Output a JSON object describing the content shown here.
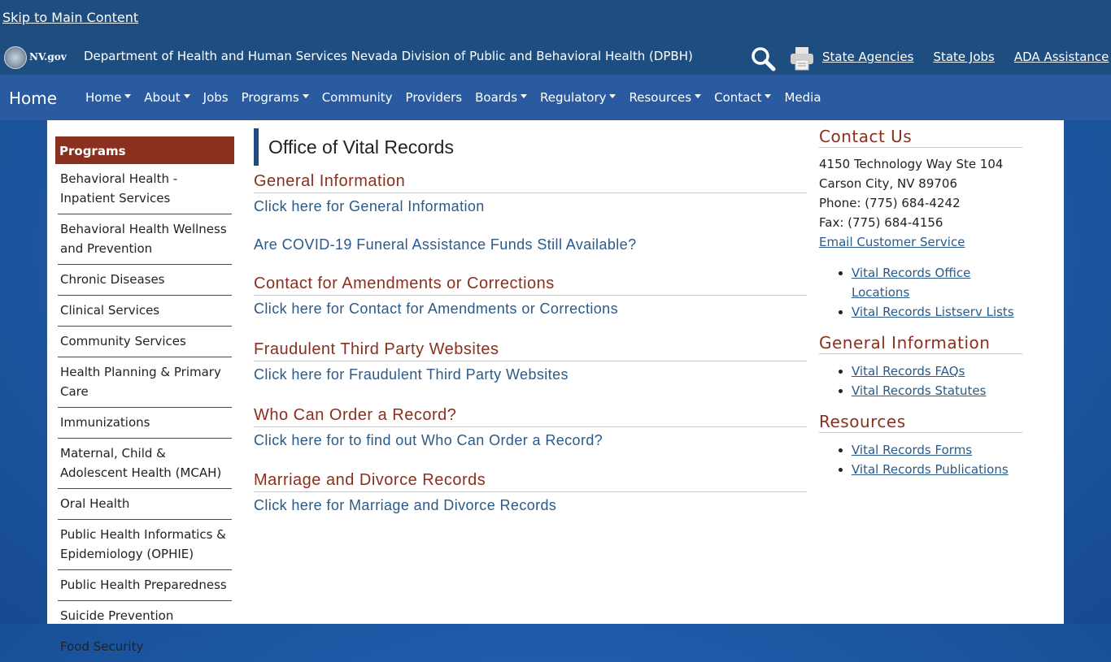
{
  "skip_link": "Skip to Main Content",
  "header": {
    "logo_text": "NV.gov",
    "agency_title": "Department of Health and Human Services Nevada Division of Public and Behavioral Health (DPBH)",
    "links": [
      "State Agencies",
      "State Jobs",
      "ADA Assistance"
    ]
  },
  "nav": {
    "brand": "Home",
    "items": [
      {
        "label": "Home",
        "dropdown": true
      },
      {
        "label": "About",
        "dropdown": true
      },
      {
        "label": "Jobs",
        "dropdown": false
      },
      {
        "label": "Programs",
        "dropdown": true
      },
      {
        "label": "Community",
        "dropdown": false
      },
      {
        "label": "Providers",
        "dropdown": false
      },
      {
        "label": "Boards",
        "dropdown": true
      },
      {
        "label": "Regulatory",
        "dropdown": true
      },
      {
        "label": "Resources",
        "dropdown": true
      },
      {
        "label": "Contact",
        "dropdown": true
      },
      {
        "label": "Media",
        "dropdown": false
      }
    ]
  },
  "sidebar": {
    "heading": "Programs",
    "items": [
      "Behavioral Health - Inpatient Services",
      "Behavioral Health Wellness and Prevention",
      "Chronic Diseases",
      "Clinical Services",
      "Community Services",
      "Health Planning & Primary Care",
      "Immunizations",
      "Maternal, Child & Adolescent Health (MCAH)",
      "Oral Health",
      "Public Health Informatics & Epidemiology (OPHIE)",
      "Public Health Preparedness",
      "Suicide Prevention",
      "Food Security"
    ]
  },
  "main": {
    "title": "Office of Vital Records",
    "sections": [
      {
        "heading": "General Information",
        "link": "Click here for General Information"
      },
      {
        "heading": "Contact for Amendments or Corrections",
        "link": "Click here for Contact for Amendments or Corrections"
      },
      {
        "heading": "Fraudulent Third Party Websites",
        "link": "Click here for Fraudulent Third Party Websites"
      },
      {
        "heading": "Who Can Order a Record?",
        "link": "Click here for to find out Who Can Order a Record?"
      },
      {
        "heading": "Marriage and Divorce Records",
        "link": "Click here for Marriage and Divorce Records"
      }
    ],
    "covid_link": "Are COVID-19 Funeral Assistance Funds Still Available?"
  },
  "right": {
    "contact_heading": "Contact Us",
    "address_line1": "4150 Technology Way Ste 104",
    "address_line2": "Carson City, NV 89706",
    "phone": "Phone: (775) 684-4242",
    "fax": "Fax: (775) 684-4156",
    "email_link": "Email Customer Service",
    "contact_links": [
      "Vital Records Office Locations",
      "Vital Records Listserv Lists"
    ],
    "general_heading": "General Information",
    "general_links": [
      "Vital Records FAQs",
      "Vital Records Statutes"
    ],
    "resources_heading": "Resources",
    "resources_links": [
      "Vital Records Forms",
      "Vital Records Publications"
    ]
  }
}
